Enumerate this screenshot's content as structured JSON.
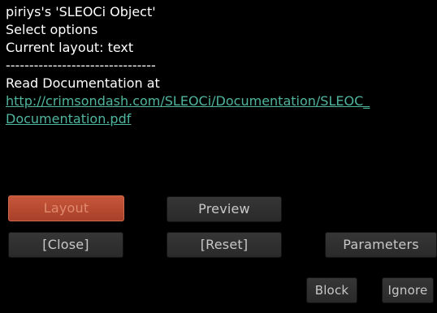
{
  "dialog": {
    "owner_line": "piriys's 'SLEOCi Object'",
    "select_line": "Select options",
    "layout_line": "Current layout: text",
    "separator": "--------------------------------",
    "read_doc_line": "Read Documentation at",
    "link_line1": "http://crimsondash.com/SLEOCi/Documentation/SLEOC_",
    "link_line2": "Documentation.pdf"
  },
  "buttons": {
    "layout": "Layout",
    "preview": "Preview",
    "close": "[Close]",
    "reset": "[Reset]",
    "parameters": "Parameters",
    "block": "Block",
    "ignore": "Ignore"
  },
  "colors": {
    "background": "#000000",
    "text": "#ffffff",
    "link": "#4fb59f",
    "button": "#303030",
    "button_text": "#c8c8c8",
    "selected_button": "#b8482e",
    "selected_button_text": "#e08a6f"
  }
}
